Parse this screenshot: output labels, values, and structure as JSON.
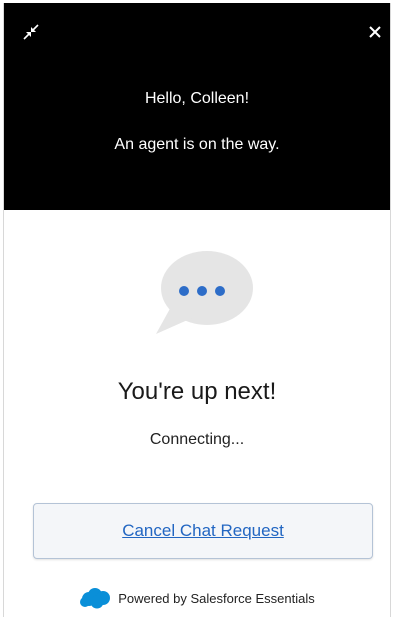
{
  "header": {
    "greeting": "Hello, Colleen!",
    "status": "An agent is on the way.",
    "minimize_icon": "minimize-arrows-icon",
    "close_icon": "close-icon"
  },
  "main": {
    "chat_icon": "chat-bubble-icon",
    "title": "You're up next!",
    "subtitle": "Connecting..."
  },
  "actions": {
    "cancel_label": "Cancel Chat Request"
  },
  "footer": {
    "logo_icon": "salesforce-cloud-icon",
    "powered_by": "Powered by Salesforce Essentials"
  },
  "colors": {
    "header_bg": "#000000",
    "link_blue": "#2266c2",
    "bubble_gray": "#e5e5e5",
    "dot_blue": "#2d6dc8",
    "salesforce_blue": "#0a8fd8"
  }
}
